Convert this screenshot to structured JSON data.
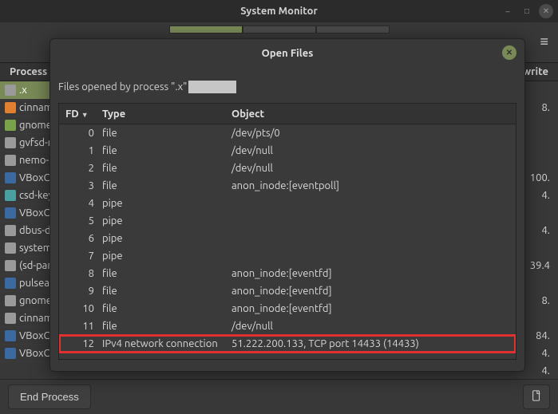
{
  "window": {
    "title": "System Monitor"
  },
  "bg_headers": {
    "left": "Process N",
    "right": "Disk write"
  },
  "bg_processes": [
    {
      "name": ".x",
      "selected": true,
      "icon": "gear"
    },
    {
      "name": "cinnam",
      "icon": "orange"
    },
    {
      "name": "gnome",
      "icon": "arrow"
    },
    {
      "name": "gvfsd-r",
      "icon": "gear"
    },
    {
      "name": "nemo-c",
      "icon": "gear"
    },
    {
      "name": "VBoxC",
      "icon": "blue"
    },
    {
      "name": "csd-key",
      "icon": "grid"
    },
    {
      "name": "VBoxC",
      "icon": "blue"
    },
    {
      "name": "dbus-d",
      "icon": "gear"
    },
    {
      "name": "system",
      "icon": "gear"
    },
    {
      "name": "(sd-par",
      "icon": "gear"
    },
    {
      "name": "pulseа",
      "icon": "blue"
    },
    {
      "name": "gnome",
      "icon": "gear"
    },
    {
      "name": "cinnam",
      "icon": "gear"
    },
    {
      "name": "VBoxC",
      "icon": "blue"
    },
    {
      "name": "VBoxC",
      "icon": "blue"
    }
  ],
  "bg_right": [
    "",
    "8.",
    "",
    "",
    "",
    "100.",
    "4.",
    "",
    "4.",
    "",
    "39.4",
    "",
    "8.",
    "",
    "84.",
    "4.",
    "4."
  ],
  "toolbar": {
    "end_process": "End Process"
  },
  "dialog": {
    "title": "Open Files",
    "description": "Files opened by process \".x\"",
    "columns": {
      "fd": "FD",
      "type": "Type",
      "object": "Object"
    },
    "rows": [
      {
        "fd": "0",
        "type": "file",
        "object": "/dev/pts/0",
        "hl": false
      },
      {
        "fd": "1",
        "type": "file",
        "object": "/dev/null",
        "hl": false
      },
      {
        "fd": "2",
        "type": "file",
        "object": "/dev/null",
        "hl": false
      },
      {
        "fd": "3",
        "type": "file",
        "object": "anon_inode:[eventpoll]",
        "hl": false
      },
      {
        "fd": "4",
        "type": "pipe",
        "object": "",
        "hl": false
      },
      {
        "fd": "5",
        "type": "pipe",
        "object": "",
        "hl": false
      },
      {
        "fd": "6",
        "type": "pipe",
        "object": "",
        "hl": false
      },
      {
        "fd": "7",
        "type": "pipe",
        "object": "",
        "hl": false
      },
      {
        "fd": "8",
        "type": "file",
        "object": "anon_inode:[eventfd]",
        "hl": false
      },
      {
        "fd": "9",
        "type": "file",
        "object": "anon_inode:[eventfd]",
        "hl": false
      },
      {
        "fd": "10",
        "type": "file",
        "object": "anon_inode:[eventfd]",
        "hl": false
      },
      {
        "fd": "11",
        "type": "file",
        "object": "/dev/null",
        "hl": false
      },
      {
        "fd": "12",
        "type": "IPv4 network connection",
        "object": "51.222.200.133, TCP port 14433 (14433)",
        "hl": true
      }
    ]
  }
}
